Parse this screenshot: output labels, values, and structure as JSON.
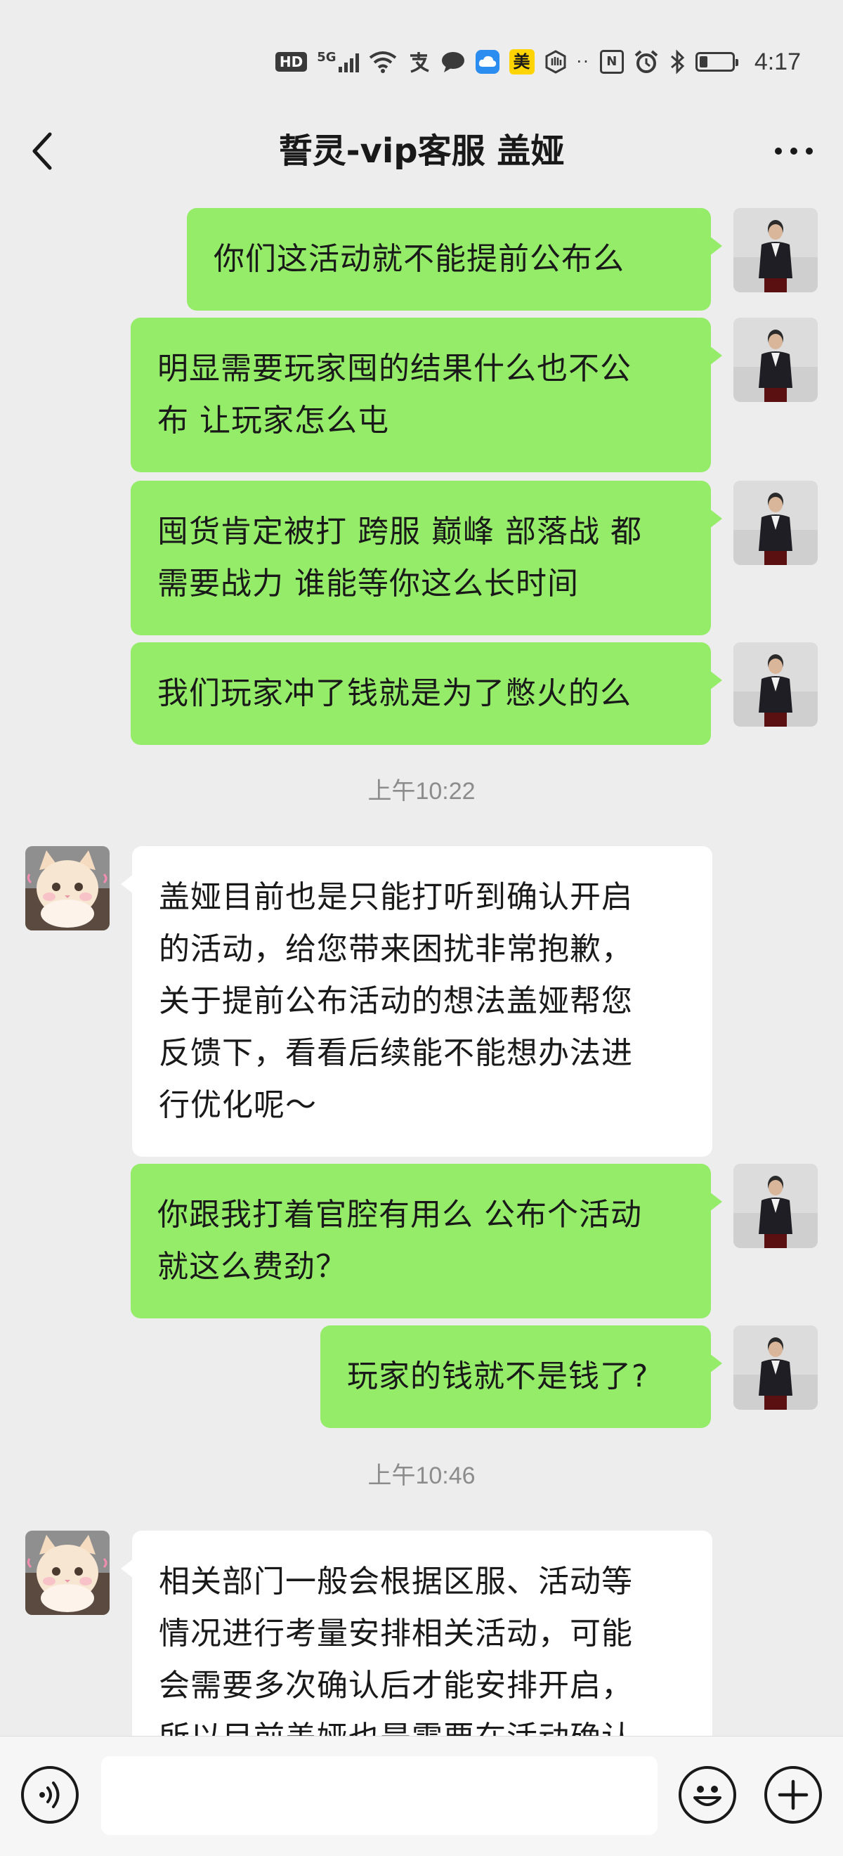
{
  "status_bar": {
    "hd": "HD",
    "network": "5G",
    "time": "4:17",
    "mei": "美",
    "icons": [
      "hd-icon",
      "signal-icon",
      "wifi-icon",
      "alipay-icon",
      "message-icon",
      "cloud-icon",
      "meituan-icon",
      "hand-icon",
      "nfc-icon",
      "alarm-icon",
      "bluetooth-icon",
      "battery-icon"
    ],
    "battery_level": 0.25
  },
  "nav": {
    "title": "誓灵-vip客服 盖娅",
    "back_icon": "back-chevron-icon",
    "more_icon": "more-dots-icon"
  },
  "messages": [
    {
      "direction": "out",
      "text": "你们这活动就不能提前公布么"
    },
    {
      "direction": "out",
      "lines": [
        "明显需要玩家囤的结果什么也不公",
        "布 让玩家怎么屯"
      ]
    },
    {
      "direction": "out",
      "lines": [
        "囤货肯定被打 跨服 巅峰 部落战 都",
        "需要战力 谁能等你这么长时间"
      ]
    },
    {
      "direction": "out",
      "text": "我们玩家冲了钱就是为了憋火的么"
    },
    {
      "type": "timestamp",
      "text": "上午10:22"
    },
    {
      "direction": "in",
      "lines": [
        "盖娅目前也是只能打听到确认开启",
        "的活动，给您带来困扰非常抱歉，",
        "关于提前公布活动的想法盖娅帮您",
        "反馈下，看看后续能不能想办法进",
        "行优化呢～"
      ]
    },
    {
      "direction": "out",
      "lines": [
        "你跟我打着官腔有用么 公布个活动",
        "就这么费劲？"
      ]
    },
    {
      "direction": "out",
      "text": "玩家的钱就不是钱了?"
    },
    {
      "type": "timestamp",
      "text": "上午10:46"
    },
    {
      "direction": "in",
      "lines": [
        "相关部门一般会根据区服、活动等",
        "情况进行考量安排相关活动，可能",
        "会需要多次确认后才能安排开启，",
        "所以目前盖娅也是需要在活动确认"
      ]
    }
  ],
  "input_bar": {
    "voice_icon": "voice-icon",
    "emoji_icon": "emoji-icon",
    "plus_icon": "plus-icon",
    "text_value": ""
  },
  "colors": {
    "background": "#ededed",
    "outgoing_bubble": "#95ec69",
    "incoming_bubble": "#ffffff",
    "timestamp": "#8c8c8c"
  }
}
